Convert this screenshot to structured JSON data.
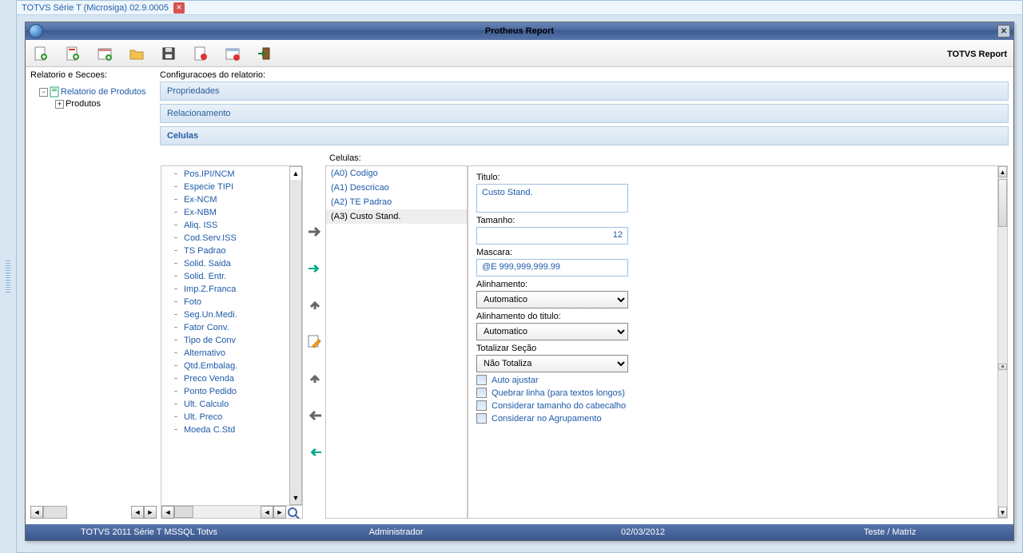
{
  "outer_tab": {
    "title": "TOTVS Série T  (Microsiga) 02.9.0005"
  },
  "window": {
    "title": "Protheus Report",
    "brand": "TOTVS Report"
  },
  "left": {
    "label": "Relatorio e Secoes:",
    "tree": {
      "root": "Relatorio de Produtos",
      "child": "Produtos"
    }
  },
  "right": {
    "label": "Configuracoes do relatorio:",
    "headers": {
      "propriedades": "Propriedades",
      "relacionamento": "Relacionamento",
      "celulas": "Celulas"
    },
    "celulas_label": "Celulas:",
    "fields": [
      "Pos.IPI/NCM",
      "Especie TIPI",
      "Ex-NCM",
      "Ex-NBM",
      "Aliq. ISS",
      "Cod.Serv.ISS",
      "TS Padrao",
      "Solid. Saida",
      "Solid. Entr.",
      "Imp.Z.Franca",
      "Foto",
      "Seg.Un.Medi.",
      "Fator Conv.",
      "Tipo de Conv",
      "Alternativo",
      "Qtd.Embalag.",
      "Preco Venda",
      "Ponto Pedido",
      "Ult. Calculo",
      "Ult. Preco",
      "Moeda C.Std"
    ],
    "cells": [
      {
        "label": "(A0) Codigo"
      },
      {
        "label": "(A1) Descricao"
      },
      {
        "label": "(A2) TE Padrao"
      },
      {
        "label": "(A3) Custo Stand."
      }
    ],
    "form": {
      "titulo_label": "Titulo:",
      "titulo": "Custo Stand.",
      "tamanho_label": "Tamanho:",
      "tamanho": "12",
      "mascara_label": "Mascara:",
      "mascara": "@E 999,999,999.99",
      "alinhamento_label": "Alinhamento:",
      "alinhamento": "Automatico",
      "alinhamento_titulo_label": "Alinhamento do titulo:",
      "alinhamento_titulo": "Automatico",
      "totalizar_label": "Totalizar Seção",
      "totalizar": "Não Totaliza",
      "chk_auto": "Auto ajustar",
      "chk_quebrar": "Quebrar linha (para textos longos)",
      "chk_cabecalho": "Considerar tamanho do cabecalho",
      "chk_agrup": "Considerar no Agrupamento"
    }
  },
  "status": {
    "left": "TOTVS 2011 Série T  MSSQL Totvs",
    "user": "Administrador",
    "date": "02/03/2012",
    "env": "Teste / Matriz"
  }
}
